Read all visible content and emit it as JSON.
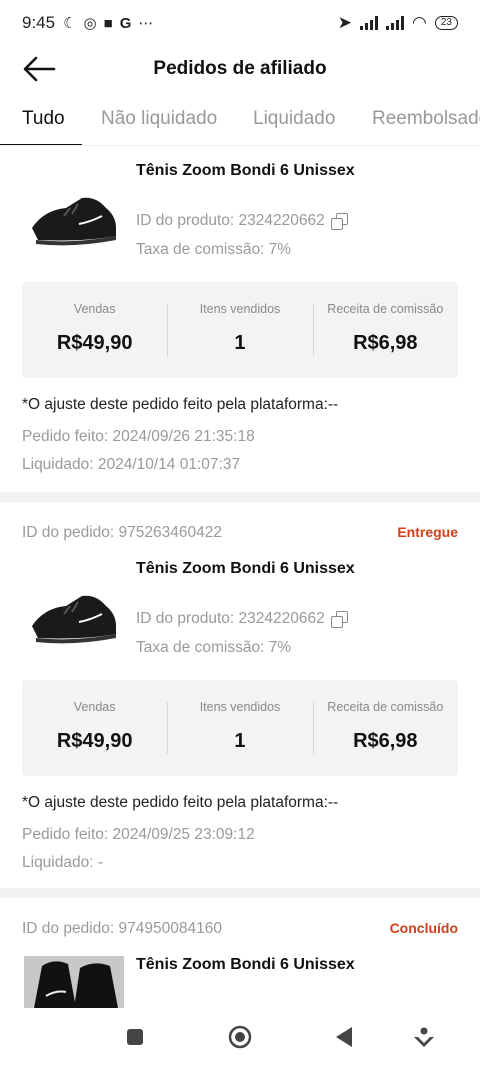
{
  "status_bar": {
    "time": "9:45",
    "battery": "23",
    "left_icons": [
      "moon-icon",
      "instagram-icon",
      "video-icon",
      "google-icon",
      "more-icon"
    ]
  },
  "header": {
    "title": "Pedidos de afiliado"
  },
  "tabs": [
    {
      "label": "Tudo"
    },
    {
      "label": "Não liquidado"
    },
    {
      "label": "Liquidado"
    },
    {
      "label": "Reembolsado"
    }
  ],
  "labels": {
    "sales": "Vendas",
    "items_sold": "Itens vendidos",
    "commission_revenue": "Receita de comissão"
  },
  "orders": [
    {
      "product_name": "Tênis Zoom Bondi 6 Unissex",
      "product_id": "ID do produto: 2324220662",
      "commission_rate": "Taxa de comissão: 7%",
      "sales": "R$49,90",
      "items_sold": "1",
      "commission": "R$6,98",
      "adjust_note": "*O ajuste deste pedido feito pela plataforma:--",
      "placed": "Pedido feito: 2024/09/26 21:35:18",
      "settled": "Liquidado: 2024/10/14 01:07:37"
    },
    {
      "order_id": "ID do pedido: 975263460422",
      "status": "Entregue",
      "product_name": "Tênis Zoom Bondi 6 Unissex",
      "product_id": "ID do produto: 2324220662",
      "commission_rate": "Taxa de comissão: 7%",
      "sales": "R$49,90",
      "items_sold": "1",
      "commission": "R$6,98",
      "adjust_note": "*O ajuste deste pedido feito pela plataforma:--",
      "placed": "Pedido feito: 2024/09/25 23:09:12",
      "settled": "Liquidado: -"
    },
    {
      "order_id": "ID do pedido: 974950084160",
      "status": "Concluído",
      "product_name": "Tênis Zoom Bondi 6 Unissex"
    }
  ],
  "colors": {
    "status": "#d2401a",
    "muted": "#9a9a9a",
    "panel": "#f3f3f3"
  }
}
